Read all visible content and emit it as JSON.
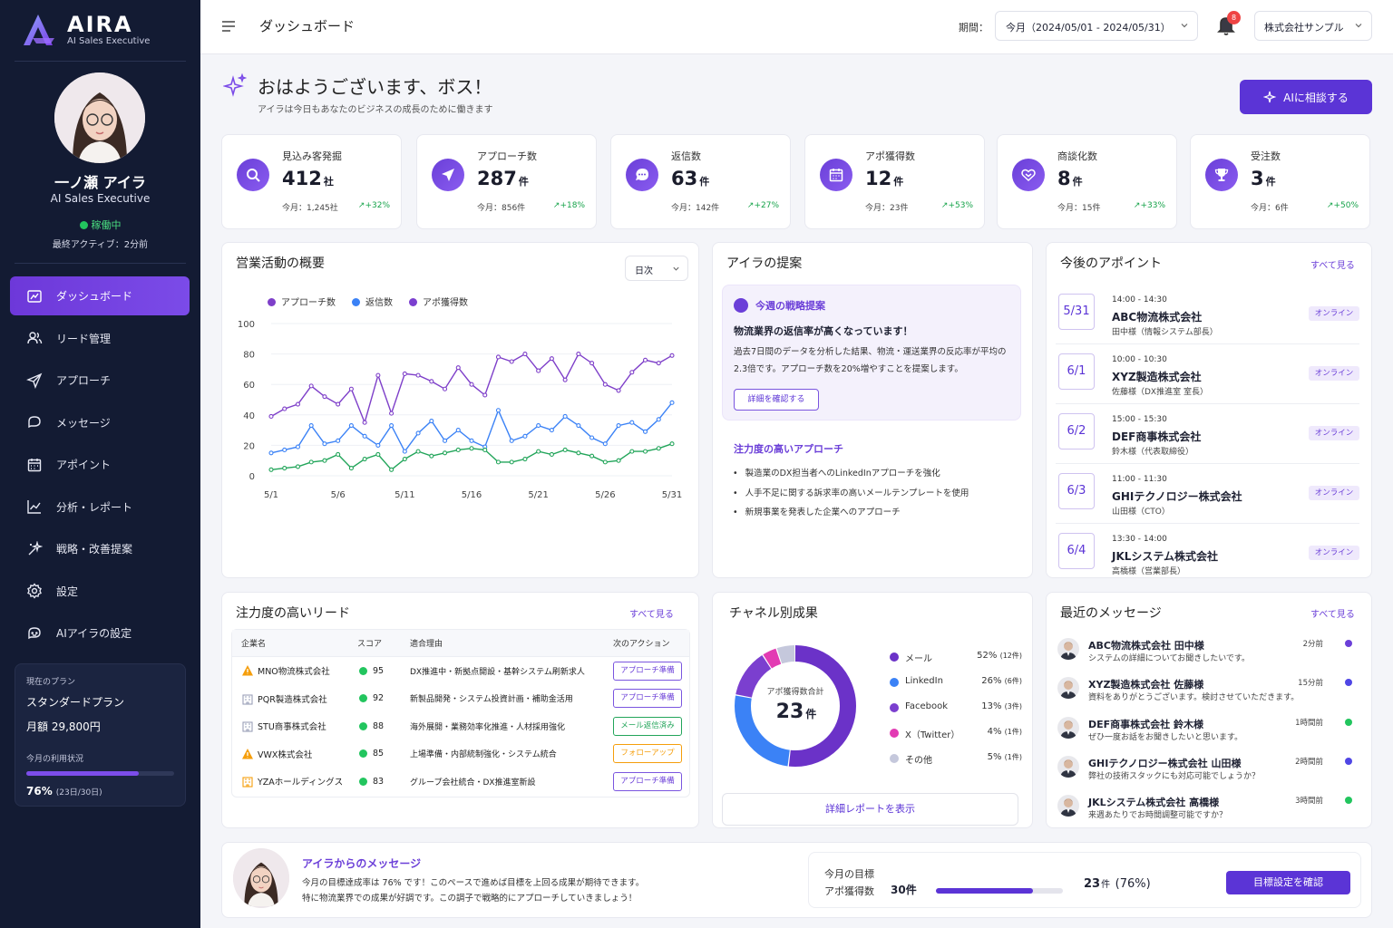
{
  "app": {
    "name": "AIRA",
    "tagline": "AI Sales Executive"
  },
  "profile": {
    "name": "一ノ瀬 アイラ",
    "role": "AI Sales Executive",
    "status": "稼働中",
    "last_active": "最終アクティブ：2分前"
  },
  "nav": [
    {
      "label": "ダッシュボード",
      "icon": "dashboard-icon",
      "active": true
    },
    {
      "label": "リード管理",
      "icon": "users-icon"
    },
    {
      "label": "アプローチ",
      "icon": "send-icon"
    },
    {
      "label": "メッセージ",
      "icon": "chat-icon"
    },
    {
      "label": "アポイント",
      "icon": "calendar-icon"
    },
    {
      "label": "分析・レポート",
      "icon": "analytics-icon"
    },
    {
      "label": "戦略・改善提案",
      "icon": "sparkle-icon"
    },
    {
      "label": "設定",
      "icon": "gear-icon"
    },
    {
      "label": "AIアイラの設定",
      "icon": "bot-icon"
    }
  ],
  "plan": {
    "label": "現在のプラン",
    "name": "スタンダードプラン",
    "price": "月額 29,800円",
    "usage_label": "今月の利用状況",
    "usage_pct": "76%",
    "usage_detail": "(23日/30日)",
    "usage_fraction": 0.76
  },
  "header": {
    "title": "ダッシュボード",
    "period_label": "期間：",
    "period_value": "今月（2024/05/01 - 2024/05/31）",
    "notifications": "8",
    "company": "株式会社サンプル"
  },
  "greeting": {
    "title": "おはようございます、ボス！",
    "subtitle": "アイラは今日もあなたのビジネスの成長のために働きます",
    "ai_button": "AIに相談する"
  },
  "kpis": [
    {
      "label": "見込み客発掘",
      "value": "412",
      "unit": "社",
      "sub": "今月：1,245社",
      "trend": "+32%",
      "icon": "search-icon"
    },
    {
      "label": "アプローチ数",
      "value": "287",
      "unit": "件",
      "sub": "今月：856件",
      "trend": "+18%",
      "icon": "send-icon"
    },
    {
      "label": "返信数",
      "value": "63",
      "unit": "件",
      "sub": "今月：142件",
      "trend": "+27%",
      "icon": "chat-icon"
    },
    {
      "label": "アポ獲得数",
      "value": "12",
      "unit": "件",
      "sub": "今月：23件",
      "trend": "+53%",
      "icon": "calendar-icon"
    },
    {
      "label": "商談化数",
      "value": "8",
      "unit": "件",
      "sub": "今月：15件",
      "trend": "+33%",
      "icon": "handshake-icon"
    },
    {
      "label": "受注数",
      "value": "3",
      "unit": "件",
      "sub": "今月：6件",
      "trend": "+50%",
      "icon": "trophy-icon"
    }
  ],
  "activity": {
    "title": "営業活動の概要",
    "period_select": "日次"
  },
  "chart_data": {
    "type": "line",
    "x": [
      "5/1",
      "5/2",
      "5/3",
      "5/4",
      "5/5",
      "5/6",
      "5/7",
      "5/8",
      "5/9",
      "5/10",
      "5/11",
      "5/12",
      "5/13",
      "5/14",
      "5/15",
      "5/16",
      "5/17",
      "5/18",
      "5/19",
      "5/20",
      "5/21",
      "5/22",
      "5/23",
      "5/24",
      "5/25",
      "5/26",
      "5/27",
      "5/28",
      "5/29",
      "5/30",
      "5/31"
    ],
    "xticks": [
      "5/1",
      "5/6",
      "5/11",
      "5/16",
      "5/21",
      "5/26",
      "5/31"
    ],
    "yticks": [
      0,
      20,
      40,
      60,
      80,
      100
    ],
    "ylim": [
      0,
      100
    ],
    "series": [
      {
        "name": "アプローチ数",
        "color": "#7e3fc9",
        "values": [
          39,
          44,
          47,
          59,
          52,
          47,
          57,
          35,
          66,
          41,
          67,
          66,
          62,
          57,
          71,
          60,
          53,
          78,
          75,
          80,
          69,
          77,
          63,
          80,
          74,
          60,
          56,
          68,
          76,
          74,
          79
        ]
      },
      {
        "name": "返信数",
        "color": "#3b82f6",
        "values": [
          15,
          17,
          19,
          33,
          21,
          23,
          33,
          26,
          20,
          33,
          16,
          28,
          36,
          23,
          30,
          23,
          19,
          43,
          23,
          26,
          33,
          30,
          39,
          33,
          25,
          21,
          33,
          35,
          29,
          37,
          48
        ]
      },
      {
        "name": "アポ獲得数",
        "color": "#22a55a",
        "values": [
          4,
          5,
          6,
          9,
          10,
          14,
          5,
          11,
          14,
          4,
          11,
          16,
          13,
          15,
          17,
          18,
          17,
          9,
          9,
          11,
          16,
          14,
          17,
          15,
          13,
          9,
          10,
          16,
          16,
          18,
          21
        ]
      }
    ]
  },
  "proposal": {
    "title": "アイラの提案",
    "box_title": "今週の戦略提案",
    "headline": "物流業界の返信率が高くなっています！",
    "body": "過去7日間のデータを分析した結果、物流・運送業界の反応率が平均の2.3倍です。アプローチ数を20%増やすことを提案します。",
    "button": "詳細を確認する",
    "focus_title": "注力度の高いアプローチ",
    "focus_items": [
      "製造業のDX担当者へのLinkedInアプローチを強化",
      "人手不足に関する訴求率の高いメールテンプレートを使用",
      "新規事業を発表した企業へのアプローチ"
    ]
  },
  "appointments": {
    "title": "今後のアポイント",
    "see_all": "すべて見る",
    "items": [
      {
        "date": "5/31",
        "time": "14:00 - 14:30",
        "company": "ABC物流株式会社",
        "person": "田中様（情報システム部長）",
        "mode": "オンライン"
      },
      {
        "date": "6/1",
        "time": "10:00 - 10:30",
        "company": "XYZ製造株式会社",
        "person": "佐藤様（DX推進室 室長）",
        "mode": "オンライン"
      },
      {
        "date": "6/2",
        "time": "15:00 - 15:30",
        "company": "DEF商事株式会社",
        "person": "鈴木様（代表取締役）",
        "mode": "オンライン"
      },
      {
        "date": "6/3",
        "time": "11:00 - 11:30",
        "company": "GHIテクノロジー株式会社",
        "person": "山田様（CTO）",
        "mode": "オンライン"
      },
      {
        "date": "6/4",
        "time": "13:30 - 14:00",
        "company": "JKLシステム株式会社",
        "person": "高橋様（営業部長）",
        "mode": "オンライン"
      }
    ]
  },
  "leads": {
    "title": "注力度の高いリード",
    "see_all": "すべて見る",
    "headers": [
      "企業名",
      "スコア",
      "適合理由",
      "次のアクション"
    ],
    "rows": [
      {
        "company": "MNO物流株式会社",
        "score": "95",
        "reason": "DX推進中・新拠点開設・基幹システム刷新求人",
        "action": "アプローチ準備",
        "action_color": "#6b3fd8",
        "icon": "warning-icon"
      },
      {
        "company": "PQR製造株式会社",
        "score": "92",
        "reason": "新製品開発・システム投資計画・補助金活用",
        "action": "アプローチ準備",
        "action_color": "#6b3fd8",
        "icon": "building-icon"
      },
      {
        "company": "STU商事株式会社",
        "score": "88",
        "reason": "海外展開・業務効率化推進・人材採用強化",
        "action": "メール返信済み",
        "action_color": "#22a55a",
        "icon": "building-icon"
      },
      {
        "company": "VWX株式会社",
        "score": "85",
        "reason": "上場準備・内部統制強化・システム統合",
        "action": "フォローアップ",
        "action_color": "#f59e0b",
        "icon": "warning-icon"
      },
      {
        "company": "YZAホールディングス",
        "score": "83",
        "reason": "グループ会社統合・DX推進室新設",
        "action": "アプローチ準備",
        "action_color": "#6b3fd8",
        "icon": "building-orange-icon"
      }
    ]
  },
  "channels": {
    "title": "チャネル別成果",
    "center_label": "アポ獲得数合計",
    "center_value": "23",
    "center_unit": "件",
    "items": [
      {
        "name": "メール",
        "pct": "52%",
        "count": "(12件)",
        "color": "#6b32c8",
        "value": 52
      },
      {
        "name": "LinkedIn",
        "pct": "26%",
        "count": "(6件)",
        "color": "#3b82f6",
        "value": 26
      },
      {
        "name": "Facebook",
        "pct": "13%",
        "count": "(3件)",
        "color": "#7b3fcf",
        "value": 13
      },
      {
        "name": "X（Twitter）",
        "pct": "4%",
        "count": "(1件)",
        "color": "#e23bb3",
        "value": 4
      },
      {
        "name": "その他",
        "pct": "5%",
        "count": "(1件)",
        "color": "#c5c8dc",
        "value": 5
      }
    ],
    "report_button": "詳細レポートを表示"
  },
  "messages": {
    "title": "最近のメッセージ",
    "see_all": "すべて見る",
    "items": [
      {
        "from": "ABC物流株式会社 田中様",
        "text": "システムの詳細についてお聞きしたいです。",
        "time": "2分前",
        "dot": "#6b3fd8"
      },
      {
        "from": "XYZ製造株式会社 佐藤様",
        "text": "資料をありがとうございます。検討させていただきます。",
        "time": "15分前",
        "dot": "#4f46e5"
      },
      {
        "from": "DEF商事株式会社 鈴木様",
        "text": "ぜひ一度お話をお聞きしたいと思います。",
        "time": "1時間前",
        "dot": "#22c55e"
      },
      {
        "from": "GHIテクノロジー株式会社 山田様",
        "text": "弊社の技術スタックにも対応可能でしょうか？",
        "time": "2時間前",
        "dot": "#4f46e5"
      },
      {
        "from": "JKLシステム株式会社 高橋様",
        "text": "来週あたりでお時間調整可能ですか？",
        "time": "3時間前",
        "dot": "#22c55e"
      }
    ]
  },
  "aira_message": {
    "title": "アイラからのメッセージ",
    "line1": "今月の目標達成率は 76% です！このペースで進めば目標を上回る成果が期待できます。",
    "line2": "特に物流業界での成果が好調です。この調子で戦略的にアプローチしていきましょう！"
  },
  "goal": {
    "label": "今月の目標",
    "metric": "アポ獲得数",
    "target": "30件",
    "actual": "23",
    "actual_unit": "件",
    "actual_pct": "(76%)",
    "fraction": 0.7667,
    "button": "目標設定を確認"
  }
}
